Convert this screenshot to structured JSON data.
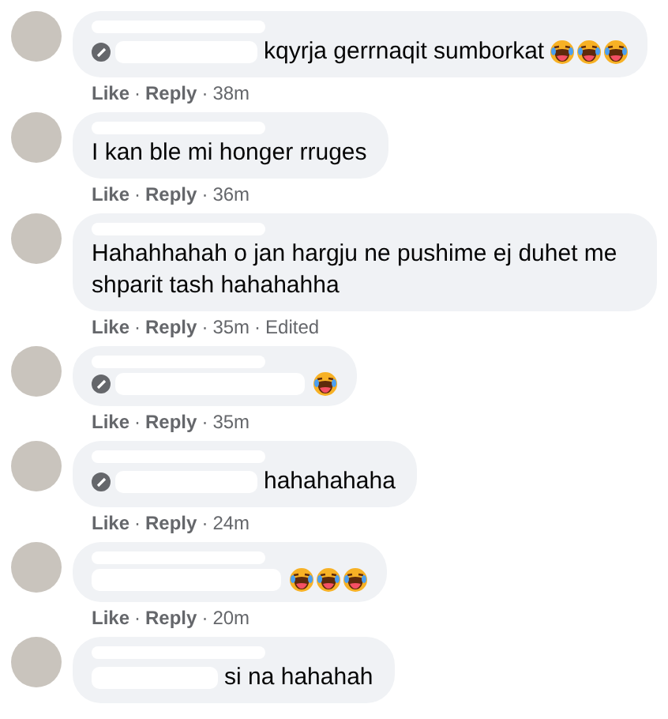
{
  "separator": "·",
  "comments": [
    {
      "tagged": true,
      "text": "kqyrja gerrnaqit sumborkat",
      "emojis": [
        {
          "kind": "laughing"
        },
        {
          "kind": "laughing"
        },
        {
          "kind": "laughing"
        }
      ],
      "actions": [
        "Like",
        "Reply"
      ],
      "time": "38m"
    },
    {
      "tagged": false,
      "text": "I kan ble mi honger rruges",
      "actions": [
        "Like",
        "Reply"
      ],
      "time": "36m"
    },
    {
      "tagged": false,
      "text": "Hahahhahah o jan hargju ne pushime ej duhet me shparit tash hahahahha",
      "actions": [
        "Like",
        "Reply"
      ],
      "time": "35m",
      "edited": "Edited"
    },
    {
      "tagged": true,
      "emojis": [
        {
          "kind": "laughing"
        }
      ],
      "actions": [
        "Like",
        "Reply"
      ],
      "time": "35m"
    },
    {
      "tagged": true,
      "text": "hahahahaha",
      "actions": [
        "Like",
        "Reply"
      ],
      "time": "24m"
    },
    {
      "tagged": false,
      "emojis": [
        {
          "kind": "laughing"
        },
        {
          "kind": "laughing"
        },
        {
          "kind": "laughing"
        }
      ],
      "actions": [
        "Like",
        "Reply"
      ],
      "time": "20m"
    },
    {
      "tagged": false,
      "text": "si na hahahah"
    }
  ]
}
